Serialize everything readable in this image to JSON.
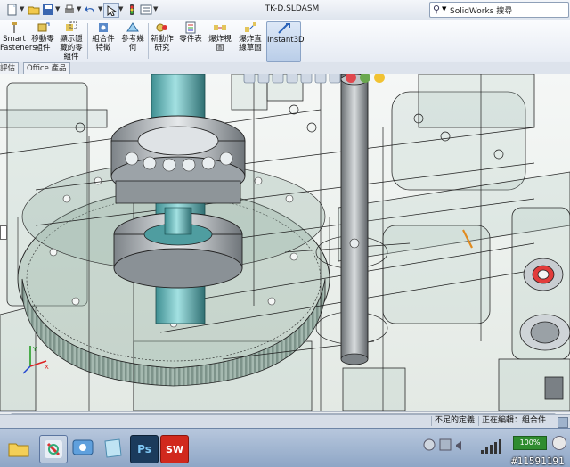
{
  "titlebar": {
    "doc_title": "TK-D.SLDASM",
    "search_text": "SolidWorks 搜尋"
  },
  "ribbon": {
    "buttons": [
      {
        "label": "Smart\nFasteners"
      },
      {
        "label": "移動零\n組件"
      },
      {
        "label": "顯示隱\n藏的零\n組件"
      },
      {
        "label": "組合件\n特徵"
      },
      {
        "label": "參考幾\n何"
      },
      {
        "label": "新動作\n研究"
      },
      {
        "label": "零件表"
      },
      {
        "label": "爆炸視\n圖"
      },
      {
        "label": "爆炸直\n線草圖"
      },
      {
        "label": "Instant3D"
      }
    ]
  },
  "tabs": [
    {
      "label": "評估"
    },
    {
      "label": "Office 產品"
    }
  ],
  "status": {
    "under_defined": "不足的定義",
    "editing": "正在編輯：組合件"
  },
  "taskbar": {
    "ps_label": "Ps",
    "sw_label": "SW",
    "battery": "100%"
  },
  "watermark": "#11591191",
  "colors": {
    "gear_green": "#9fb7ab",
    "model_line": "#1a1a1a",
    "cyan_shaft": "#7fc6c8",
    "bearing": "#c7cbd0",
    "selection_orange": "#e08a1e"
  }
}
